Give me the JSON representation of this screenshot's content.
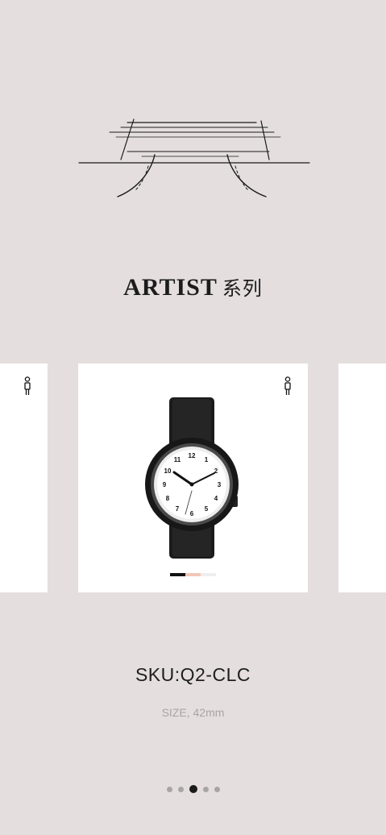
{
  "series": {
    "name": "ARTIST",
    "suffix": "系列"
  },
  "product": {
    "sku": "SKU:Q2-CLC",
    "size": "SIZE, 42mm",
    "swatch_colors": [
      "#111111",
      "#f2c7b8",
      "#eeeeee"
    ]
  },
  "icons": {
    "logo": "table-line-art-logo",
    "person": "person-standing-icon",
    "watch": "wristwatch-image"
  },
  "carousel": {
    "total": 5,
    "active_index": 2
  }
}
